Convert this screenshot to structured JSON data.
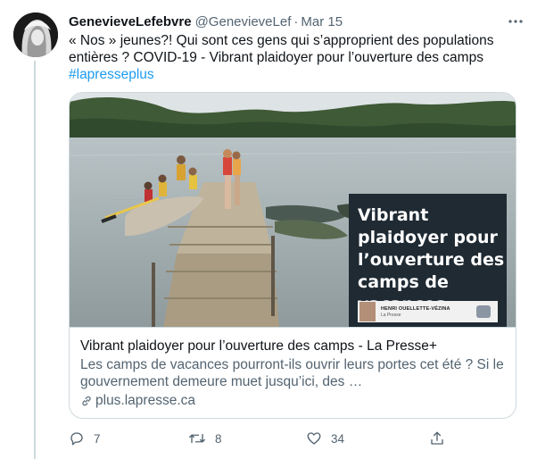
{
  "tweet": {
    "display_name": "GenevieveLefebvre",
    "handle": "@GenevieveLef",
    "separator": "·",
    "date": "Mar 15",
    "text_main": "« Nos » jeunes?! Qui sont ces gens qui s’approprient des populations entières ? COVID-19 - Vibrant plaidoyer pour l’ouverture des camps ",
    "hashtag": "#lapresseplus",
    "more_icon": "more-horizontal-icon"
  },
  "card": {
    "image_overlay_title": "Vibrant plaidoyer pour l’ouverture des camps de vacances",
    "author_name": "HENRI OUELLETTE-VÉZINA",
    "author_publication": "La Presse",
    "title": "Vibrant plaidoyer pour l’ouverture des camps - La Presse+",
    "description": "Les camps de vacances pourront-ils ouvrir leurs portes cet été ? Si le gouvernement demeure muet jusqu’ici, des …",
    "domain": "plus.lapresse.ca",
    "domain_icon": "link-icon"
  },
  "actions": {
    "reply": {
      "icon": "reply-icon",
      "count": "7"
    },
    "retweet": {
      "icon": "retweet-icon",
      "count": "8"
    },
    "like": {
      "icon": "heart-icon",
      "count": "34"
    },
    "share": {
      "icon": "share-icon"
    }
  },
  "colors": {
    "text": "#0f1419",
    "secondary": "#536471",
    "link": "#1d9bf0",
    "border": "#cfd9de"
  }
}
